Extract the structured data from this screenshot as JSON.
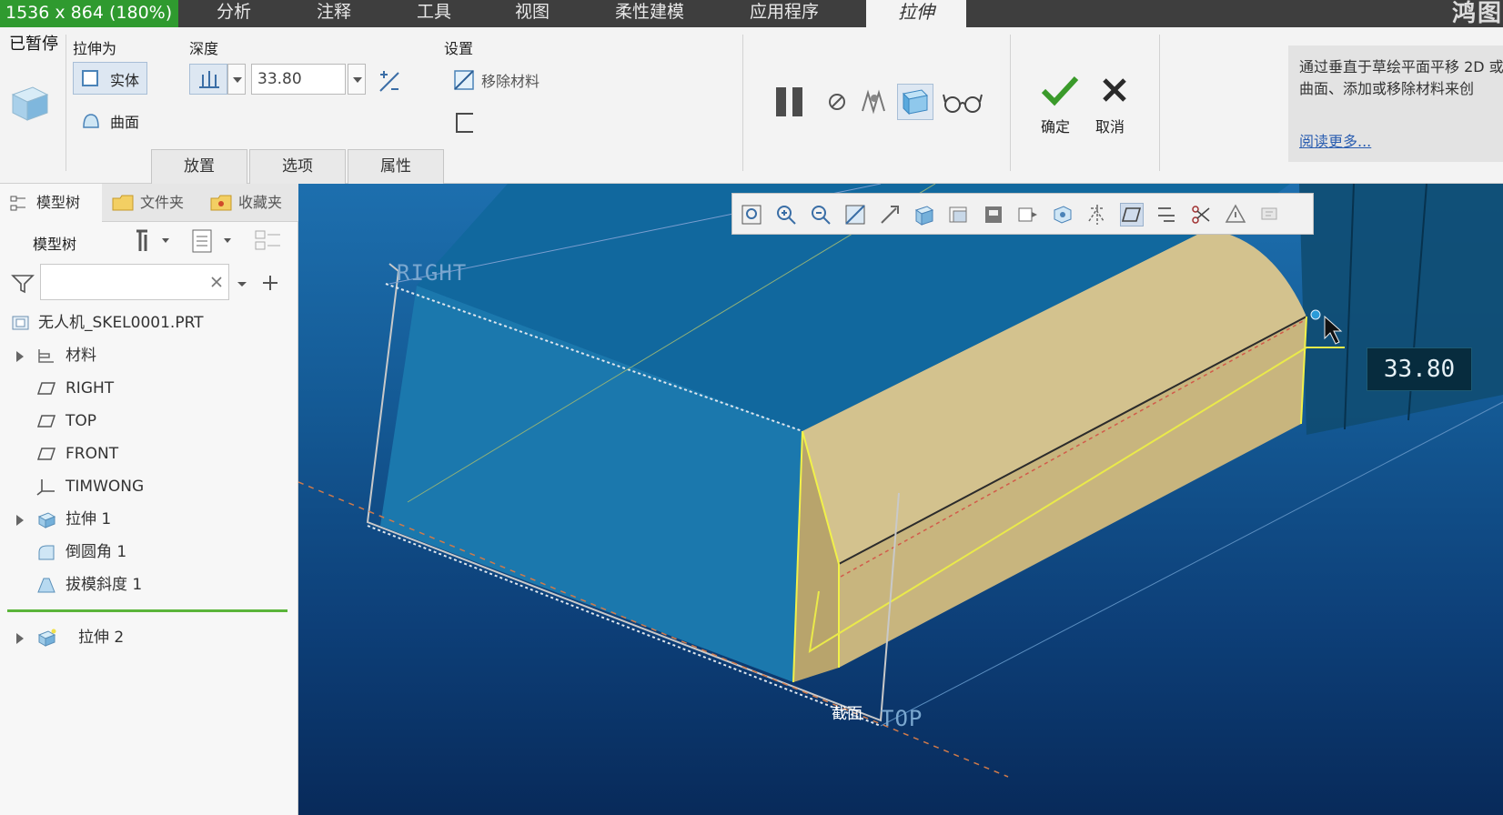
{
  "menubar": {
    "resolution": "1536 x 864 (180%)",
    "items": [
      "分析",
      "注释",
      "工具",
      "视图",
      "柔性建模",
      "应用程序"
    ],
    "active_tab": "拉伸",
    "watermark": "鸿图"
  },
  "status": {
    "paused": "已暂停"
  },
  "ribbon": {
    "extrude_as_label": "拉伸为",
    "solid_label": "实体",
    "surface_label": "曲面",
    "depth_label": "深度",
    "depth_value": "33.80",
    "settings_label": "设置",
    "remove_material_label": "移除材料",
    "ok_label": "确定",
    "cancel_label": "取消",
    "tabs": [
      "放置",
      "选项",
      "属性"
    ],
    "info_text": "通过垂直于草绘平面平移 2D 或曲面、添加或移除材料来创",
    "info_link": "阅读更多..."
  },
  "panel": {
    "tabs": [
      "模型树",
      "文件夹",
      "收藏夹"
    ],
    "tree_title": "模型树",
    "search_placeholder": "",
    "items": [
      {
        "label": "无人机_SKEL0001.PRT",
        "icon": "part-icon",
        "expand": false
      },
      {
        "label": "材料",
        "icon": "material-icon",
        "expand": true
      },
      {
        "label": "RIGHT",
        "icon": "datum-plane-icon",
        "expand": false
      },
      {
        "label": "TOP",
        "icon": "datum-plane-icon",
        "expand": false
      },
      {
        "label": "FRONT",
        "icon": "datum-plane-icon",
        "expand": false
      },
      {
        "label": "TIMWONG",
        "icon": "coordinate-system-icon",
        "expand": false
      },
      {
        "label": "拉伸 1",
        "icon": "extrude-icon",
        "expand": true
      },
      {
        "label": "倒圆角 1",
        "icon": "round-icon",
        "expand": false
      },
      {
        "label": "拔模斜度 1",
        "icon": "draft-icon",
        "expand": false
      },
      {
        "label": "拉伸 2",
        "icon": "extrude-icon",
        "expand": true
      }
    ]
  },
  "viewport": {
    "dimension_value": "33.80",
    "datum_right": "RIGHT",
    "datum_top": "TOP",
    "section_label": "截面",
    "colors": {
      "body": "#c9b781",
      "face": "#1b78ad",
      "highlight": "#f2f24a"
    }
  }
}
